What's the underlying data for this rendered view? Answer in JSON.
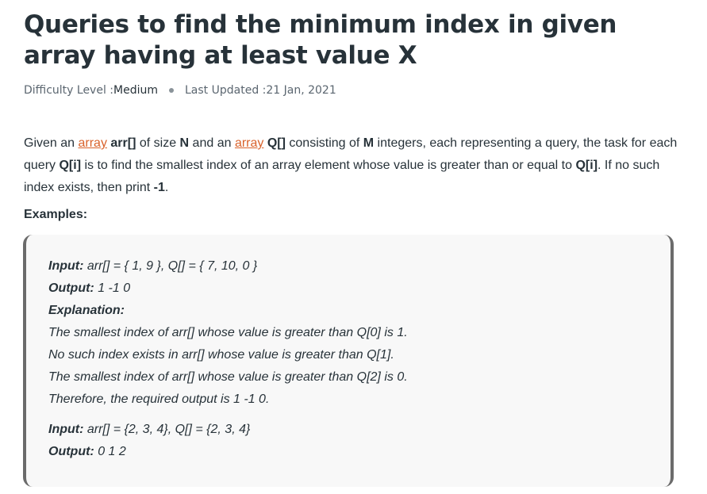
{
  "article": {
    "title": "Queries to find the minimum index in given array having at least value X",
    "meta": {
      "difficulty_label": "Difficulty Level : ",
      "difficulty_value": "Medium",
      "updated_label": "Last Updated : ",
      "updated_value": "21 Jan, 2021"
    },
    "paragraph": {
      "t1": "Given an ",
      "link1": "array",
      "t2": " ",
      "b1": "arr[]",
      "t3": " of size ",
      "b2": "N",
      "t4": " and an ",
      "link2": "array",
      "t5": " ",
      "b3": "Q[]",
      "t6": " consisting of ",
      "b4": "M",
      "t7": " integers, each representing a query, the task for each query ",
      "b5": "Q[i]",
      "t8": " is to find the smallest index of an array element whose value is greater than or equal to ",
      "b6": "Q[i]",
      "t9": ". If no such index exists, then print ",
      "b7": "-1",
      "t10": "."
    },
    "examples_label": "Examples:",
    "example1": {
      "input_label": "Input:",
      "input_value": " arr[] = { 1, 9 }, Q[] = { 7, 10, 0 }",
      "output_label": "Output:",
      "output_value": " 1 -1 0",
      "explanation_label": "Explanation:",
      "lines": [
        "The smallest index of arr[] whose value is greater than Q[0] is 1.",
        "No such index exists in arr[] whose value is greater than Q[1].",
        "The smallest index of arr[] whose value is greater than Q[2] is 0.",
        "Therefore, the required output is 1 -1 0."
      ]
    },
    "example2": {
      "input_label": "Input:",
      "input_value": " arr[] = {2, 3, 4}, Q[] = {2, 3, 4}",
      "output_label": "Output:",
      "output_value": " 0 1 2"
    }
  }
}
